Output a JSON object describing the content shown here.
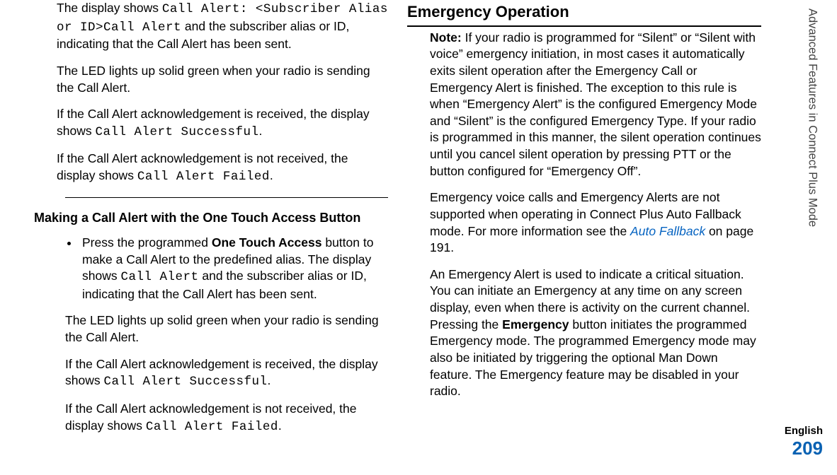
{
  "sidebar_title": "Advanced Features in Connect Plus Mode",
  "page_number": "209",
  "language": "English",
  "left": {
    "p1_a": "The display shows ",
    "p1_code1": "Call Alert: <Subscriber Alias or ID>Call Alert",
    "p1_b": " and the subscriber alias or ID, indicating that the Call Alert has been sent.",
    "p2": "The LED lights up solid green when your radio is sending the Call Alert.",
    "p3_a": "If the Call Alert acknowledgement is received, the display shows ",
    "p3_code": "Call Alert Successful",
    "p3_b": ".",
    "p4_a": "If the Call Alert acknowledgement is not received, the display shows ",
    "p4_code": "Call Alert Failed",
    "p4_b": ".",
    "heading": "Making a Call Alert with the One Touch Access Button",
    "b1_a": "Press the programmed ",
    "b1_bold": "One Touch Access",
    "b1_b": " button to make a Call Alert to the predefined alias. The display shows ",
    "b1_code": "Call Alert",
    "b1_c": " and the subscriber alias or ID, indicating that the Call Alert has been sent.",
    "p5": "The LED lights up solid green when your radio is sending the Call Alert.",
    "p6_a": "If the Call Alert acknowledgement is received, the display shows ",
    "p6_code": "Call Alert Successful",
    "p6_b": ".",
    "p7_a": "If the Call Alert acknowledgement is not received, the display shows ",
    "p7_code": "Call Alert Failed",
    "p7_b": "."
  },
  "right": {
    "section_heading": "Emergency Operation",
    "note_label": "Note:",
    "note_body": " If your radio is programmed for “Silent” or “Silent with voice” emergency initiation, in most cases it automatically exits silent operation after the Emergency Call or Emergency Alert is finished. The exception to this rule is when “Emergency Alert” is the configured Emergency Mode and “Silent” is the configured Emergency Type. If your radio is programmed in this manner, the silent operation continues until you cancel silent operation by pressing PTT or the button configured for “Emergency Off”.",
    "p2_a": "Emergency voice calls and Emergency Alerts are not supported when operating in Connect Plus Auto Fallback mode. For more information see the ",
    "p2_link": "Auto Fallback",
    "p2_b": " on page 191.",
    "p3_a": "An Emergency Alert is used to indicate a critical situation. You can initiate an Emergency at any time on any screen display, even when there is activity on the current channel. Pressing the ",
    "p3_bold": "Emergency",
    "p3_b": " button initiates the programmed Emergency mode. The programmed Emergency mode may also be initiated by triggering the optional Man Down feature. The Emergency feature may be disabled in your radio."
  }
}
